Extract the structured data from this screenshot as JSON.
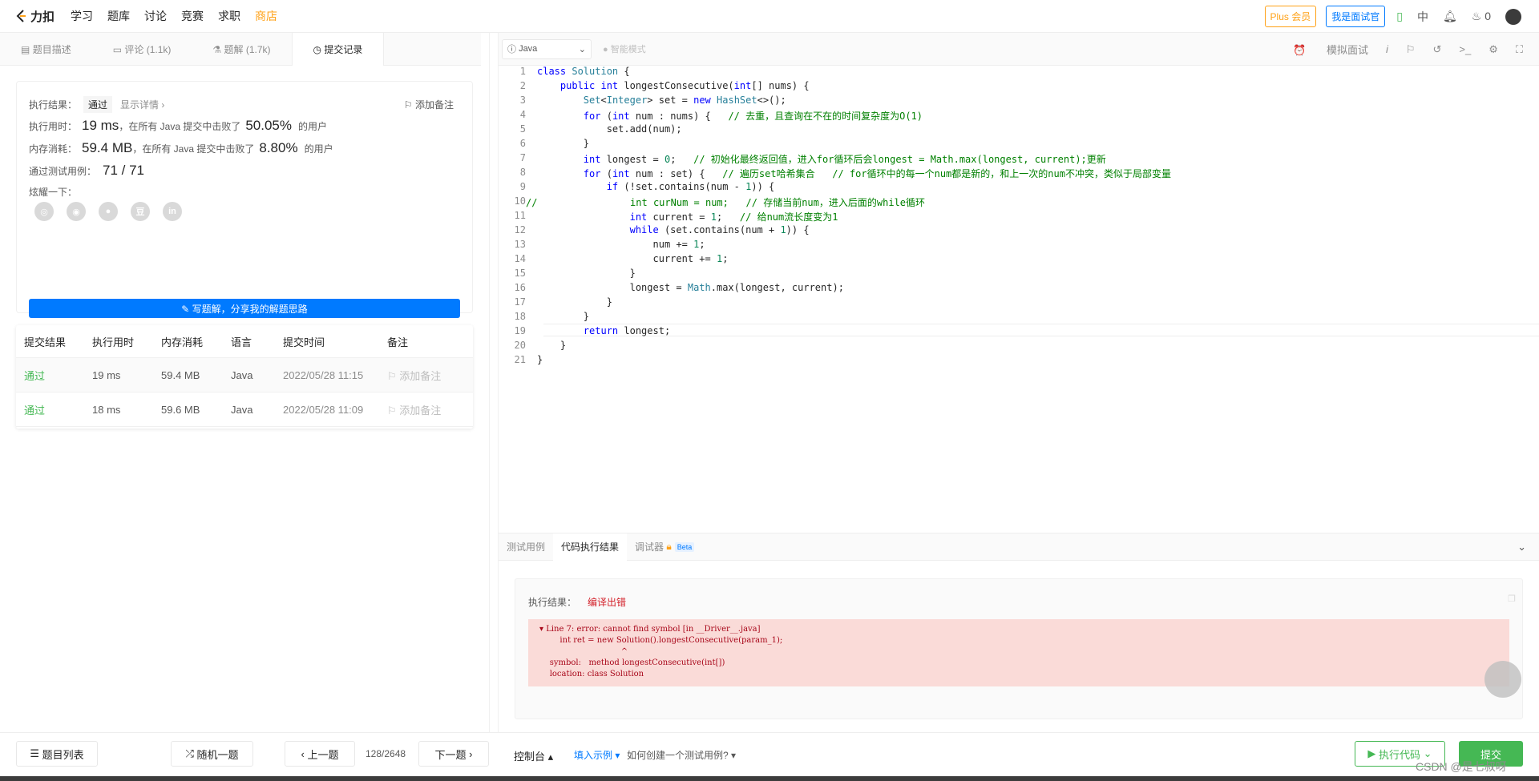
{
  "nav": {
    "brand": "力扣",
    "items": [
      "学习",
      "题库",
      "讨论",
      "竞赛",
      "求职",
      "商店"
    ],
    "plus": "Plus 会员",
    "interviewer": "我是面试官",
    "lang": "中",
    "points": "0"
  },
  "left_tabs": [
    "题目描述",
    "评论 (1.1k)",
    "题解 (1.7k)",
    "提交记录"
  ],
  "result": {
    "exec_label": "执行结果：",
    "status": "通过",
    "detail": "显示详情 ›",
    "add_note": "添加备注",
    "time_label": "执行用时：",
    "time_value": "19 ms",
    "time_mid": "，在所有 Java 提交中击败了",
    "time_pct": "50.05%",
    "time_tail": "的用户",
    "mem_label": "内存消耗：",
    "mem_value": "59.4 MB",
    "mem_mid": "，在所有 Java 提交中击败了",
    "mem_pct": "8.80%",
    "mem_tail": "的用户",
    "tests_label": "通过测试用例：",
    "tests_value": "71 / 71",
    "share_label": "炫耀一下：",
    "write_btn": "✎ 写题解，分享我的解题思路"
  },
  "submissions": {
    "headers": [
      "提交结果",
      "执行用时",
      "内存消耗",
      "语言",
      "提交时间",
      "备注"
    ],
    "rows": [
      {
        "status": "通过",
        "time": "19 ms",
        "mem": "59.4 MB",
        "lang": "Java",
        "date": "2022/05/28 11:15",
        "note": "添加备注"
      },
      {
        "status": "通过",
        "time": "18 ms",
        "mem": "59.6 MB",
        "lang": "Java",
        "date": "2022/05/28 11:09",
        "note": "添加备注"
      }
    ]
  },
  "editor": {
    "language": "Java",
    "smart_mode": "智能模式",
    "mock_interview": "模拟面试"
  },
  "bottom_tabs": [
    "测试用例",
    "代码执行结果",
    "调试器"
  ],
  "beta": "Beta",
  "run_result": {
    "label": "执行结果：",
    "status": "编译出错",
    "error": "▾ Line 7: error: cannot find symbol [in __Driver__.java]\n        int ret = new Solution().longestConsecutive(param_1);\n                                ^\n    symbol:   method longestConsecutive(int[])\n    location: class Solution"
  },
  "bottombar": {
    "problem_list": "题目列表",
    "random": "随机一题",
    "prev": "上一题",
    "page": "128/2648",
    "next": "下一题",
    "console": "控制台 ▴",
    "fill_example": "填入示例 ▾",
    "how_create": "如何创建一个测试用例? ▾",
    "run": "执行代码",
    "submit": "提交"
  },
  "watermark": "CSDN @是七叔呀"
}
